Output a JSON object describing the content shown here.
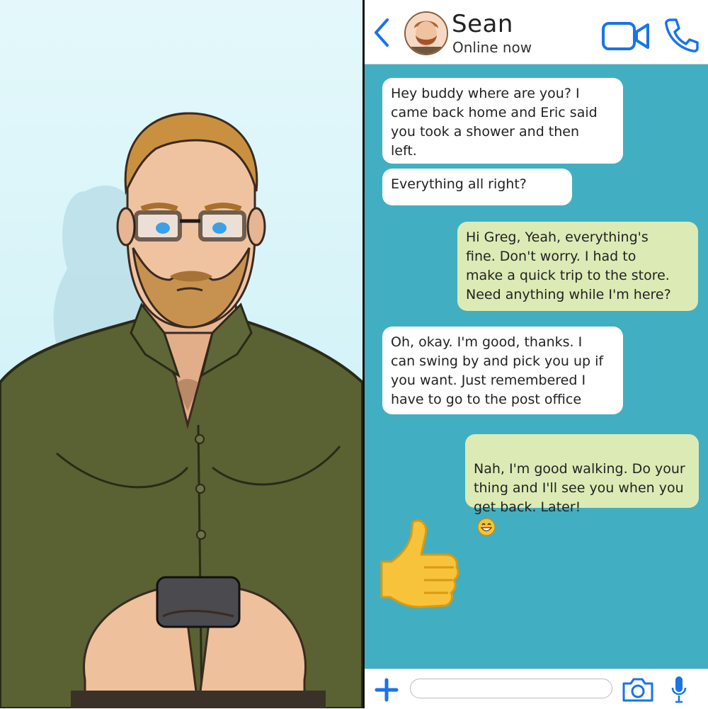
{
  "header": {
    "contact_name": "Sean",
    "status": "Online now"
  },
  "messages": [
    {
      "direction": "incoming",
      "text": "Hey buddy where are you? I\ncame back home and Eric said\nyou took a shower and then\nleft."
    },
    {
      "direction": "incoming",
      "text": "Everything all right?"
    },
    {
      "direction": "outgoing",
      "text": "Hi Greg, Yeah, everything's\nfine. Don't worry. I had to\nmake a quick trip to the store.\nNeed anything while I'm here?"
    },
    {
      "direction": "incoming",
      "text": "Oh, okay. I'm good, thanks. I\ncan swing by and pick you up if\nyou want. Just remembered I\nhave to go to the post office"
    },
    {
      "direction": "outgoing",
      "text": "Nah, I'm good walking. Do your\nthing and I'll see you when you\nget back. Later!",
      "emoji": "grinning-face"
    },
    {
      "direction": "outgoing",
      "sticker": "thumbs-up"
    }
  ],
  "input": {
    "placeholder": ""
  },
  "icons": {
    "back": "chevron-left-icon",
    "video": "video-camera-icon",
    "call": "phone-icon",
    "attach": "plus-icon",
    "camera": "camera-icon",
    "mic": "microphone-icon"
  },
  "colors": {
    "accent": "#1a73e8",
    "chat_background": "#41afc1",
    "incoming_bubble": "#ffffff",
    "outgoing_bubble": "#dcebb5"
  }
}
